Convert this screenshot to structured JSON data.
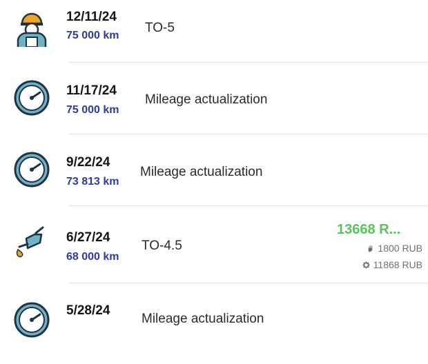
{
  "entries": [
    {
      "date": "12/11/24",
      "mileage": "75 000 km",
      "title": "TO-5",
      "icon": "mechanic-icon"
    },
    {
      "date": "11/17/24",
      "mileage": "75 000 km",
      "title": "Mileage actualization",
      "icon": "odometer-icon"
    },
    {
      "date": "9/22/24",
      "mileage": "73 813 km",
      "title": "Mileage actualization",
      "icon": "odometer-icon"
    },
    {
      "date": "6/27/24",
      "mileage": "68 000 km",
      "title": "TO-4.5",
      "icon": "oil-can-icon",
      "total": "13668 R...",
      "labor_cost": "1800 RUB",
      "parts_cost": "11868 RUB"
    },
    {
      "date": "5/28/24",
      "mileage": "",
      "title": "Mileage actualization",
      "icon": "odometer-icon"
    }
  ],
  "colors": {
    "mileage": "#2f3aa0",
    "total": "#59c25a",
    "divider": "#e2e2e2"
  }
}
